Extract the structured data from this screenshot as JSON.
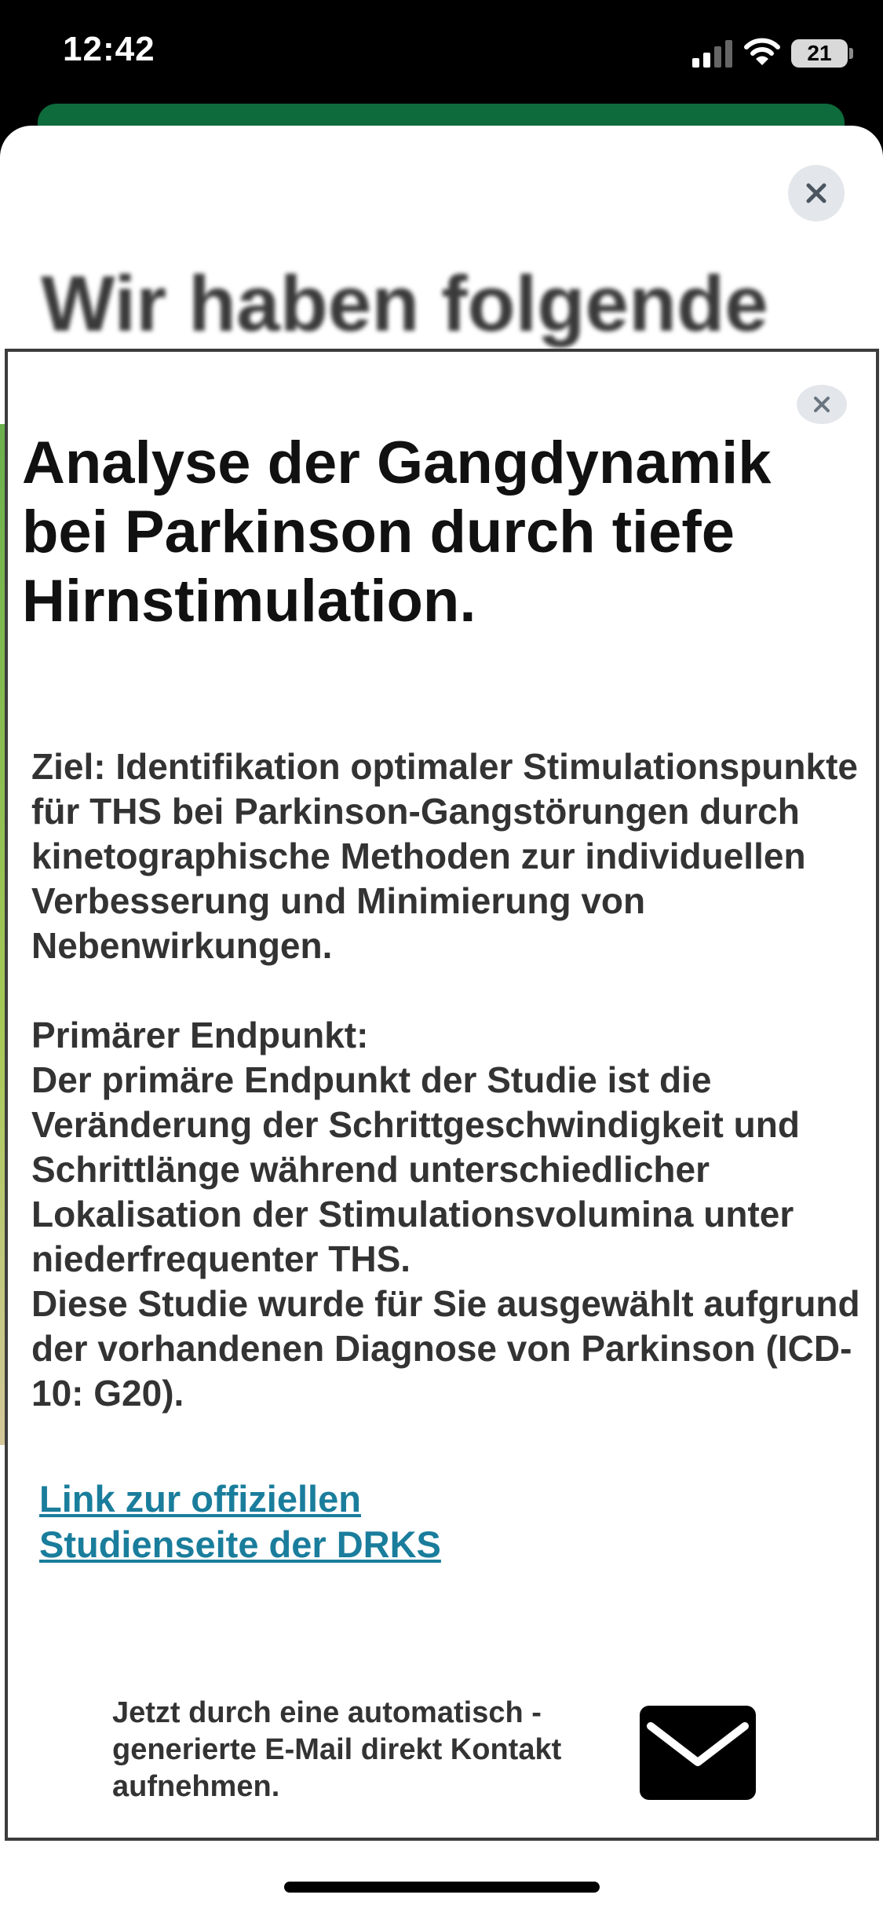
{
  "status_bar": {
    "time": "12:42",
    "battery": "21"
  },
  "background": {
    "title": "Wir haben folgende"
  },
  "modal": {
    "title": "Analyse der Gangdynamik bei Parkinson durch tiefe Hirnstimulation.",
    "objective": "Ziel: Identifikation optimaler Stimulationspunkte für THS bei Parkinson-Gangstörungen durch kinetographische Methoden zur individuellen Verbesserung und Minimierung von Nebenwirkungen.",
    "endpoint_heading": "Primärer Endpunkt:",
    "endpoint_text": "Der primäre Endpunkt der Studie ist die Veränderung der Schrittgeschwindigkeit und Schrittlänge während unterschiedlicher Lokalisation der Stimulationsvolumina unter niederfrequenter THS.",
    "selection_reason": "Diese Studie wurde für Sie ausgewählt aufgrund der vorhandenen Diagnose von Parkinson (ICD-10: G20).",
    "link_label": "Link zur offiziellen Studienseite der DRKS",
    "contact_text": "Jetzt durch eine automatisch - generierte E-Mail direkt Kontakt aufnehmen."
  },
  "icons": {
    "close": "close-icon",
    "mail": "mail-icon",
    "wifi": "wifi-icon",
    "signal": "signal-icon"
  },
  "colors": {
    "brand_green": "#0e6b3c",
    "link": "#1a7d9c",
    "text": "#333333"
  }
}
